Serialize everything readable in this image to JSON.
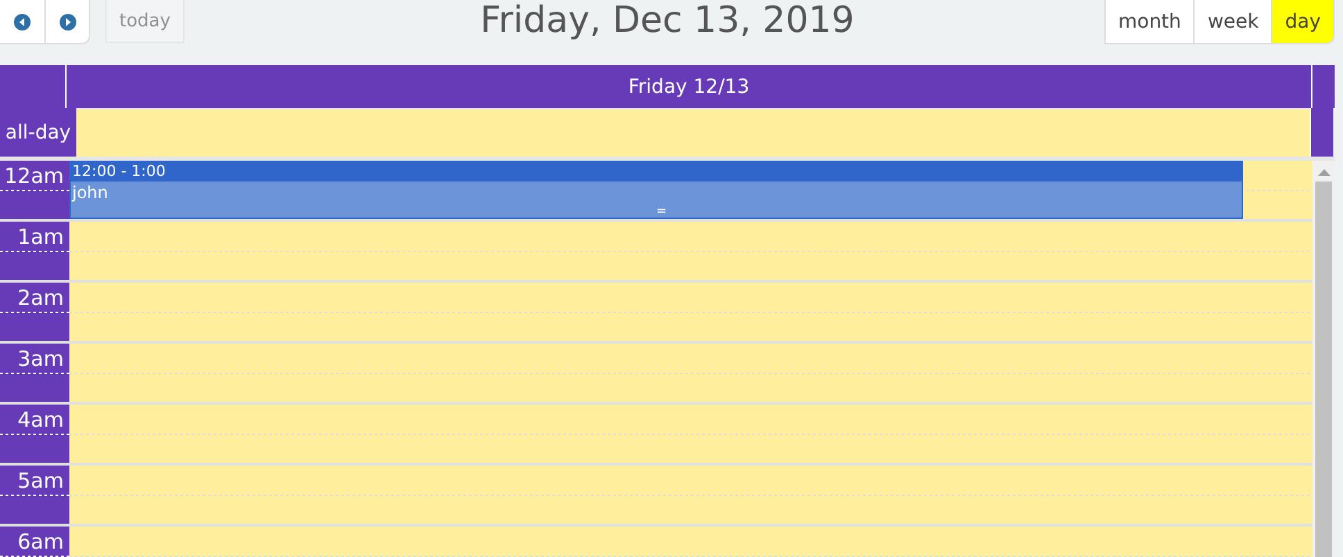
{
  "toolbar": {
    "today": {
      "label": "today",
      "disabled": true
    },
    "title": "Friday, Dec 13, 2019",
    "views": [
      {
        "label": "month",
        "selected": false
      },
      {
        "label": "week",
        "selected": false
      },
      {
        "label": "day",
        "selected": true
      }
    ]
  },
  "day_header": "Friday 12/13",
  "all_day_label": "all-day",
  "time_slots": [
    {
      "label": "12am",
      "events": [
        {
          "time": "12:00 - 1:00",
          "title": "john",
          "resize_handle": "="
        }
      ]
    },
    {
      "label": "1am"
    },
    {
      "label": "2am"
    },
    {
      "label": "3am"
    },
    {
      "label": "4am"
    },
    {
      "label": "5am"
    },
    {
      "label": "6am"
    }
  ]
}
